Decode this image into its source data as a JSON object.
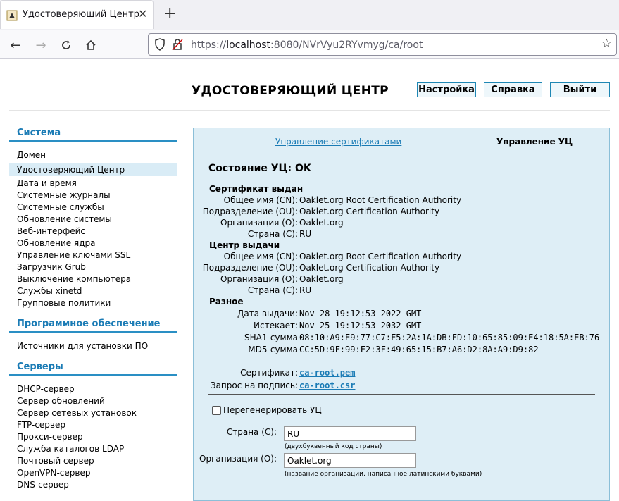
{
  "browser": {
    "tab_title": "Удостоверяющий Центр",
    "url_prefix": "https://",
    "url_host": "localhost",
    "url_rest": ":8080/NVrVyu2RYvmyg/ca/root"
  },
  "header": {
    "title": "УДОСТОВЕРЯЮЩИЙ ЦЕНТР",
    "settings_label": "Настройка",
    "help_label": "Справка",
    "logout_label": "Выйти"
  },
  "sidebar": {
    "system_head": "Система",
    "system_items": [
      "Домен",
      "Удостоверяющий Центр",
      "Дата и время",
      "Системные журналы",
      "Системные службы",
      "Обновление системы",
      "Веб-интерфейс",
      "Обновление ядра",
      "Управление ключами SSL",
      "Загрузчик Grub",
      "Выключение компьютера",
      "Службы xinetd",
      "Групповые политики"
    ],
    "software_head": "Программное обеспечение",
    "software_items": [
      "Источники для установки ПО"
    ],
    "servers_head": "Серверы",
    "servers_items": [
      "DHCP-сервер",
      "Сервер обновлений",
      "Сервер сетевых установок",
      "FTP-сервер",
      "Прокси-сервер",
      "Служба каталогов LDAP",
      "Почтовый сервер",
      "OpenVPN-сервер",
      "DNS-сервер"
    ]
  },
  "panel": {
    "tab_certs": "Управление сертификатами",
    "tab_ca": "Управление УЦ",
    "state": "Состояние УЦ: OK",
    "cert_issued_head": "Сертификат выдан",
    "issuer_head": "Центр выдачи",
    "misc_head": "Разное",
    "issued": {
      "cn_label": "Общее имя (CN):",
      "cn": "Oaklet.org Root Certification Authority",
      "ou_label": "Подразделение (OU):",
      "ou": "Oaklet.org Certification Authority",
      "o_label": "Организация (O):",
      "o": "Oaklet.org",
      "c_label": "Страна (C):",
      "c": "RU"
    },
    "issuer": {
      "cn_label": "Общее имя (CN):",
      "cn": "Oaklet.org Root Certification Authority",
      "ou_label": "Подразделение (OU):",
      "ou": "Oaklet.org Certification Authority",
      "o_label": "Организация (O):",
      "o": "Oaklet.org",
      "c_label": "Страна (C):",
      "c": "RU"
    },
    "misc": {
      "issued_label": "Дата выдачи:",
      "issued": "Nov 28 19:12:53 2022 GMT",
      "expires_label": "Истекает:",
      "expires": "Nov 25 19:12:53 2032 GMT",
      "sha1_label": "SHA1-сумма",
      "sha1": "08:10:A9:E9:77:C7:F5:2A:1A:DB:FD:10:65:85:09:E4:18:5A:EB:76",
      "md5_label": "MD5-сумма",
      "md5": "CC:5D:9F:99:F2:3F:49:65:15:B7:A6:D2:8A:A9:D9:82"
    },
    "cert_label": "Сертификат:",
    "cert_link": "ca-root.pem",
    "csr_label": "Запрос на подпись:",
    "csr_link": "ca-root.csr",
    "regen_label": "Перегенерировать УЦ",
    "country_label": "Страна (C):",
    "country_value": "RU",
    "country_hint": "(двухбуквенный код страны)",
    "org_label": "Организация (O):",
    "org_value": "Oaklet.org",
    "org_hint": "(название организации, написанное латинскими буквами)"
  },
  "colors": {
    "accent": "#1a7bb5",
    "panel_bg": "#deeef6",
    "active_bg": "#d9ecf6"
  }
}
